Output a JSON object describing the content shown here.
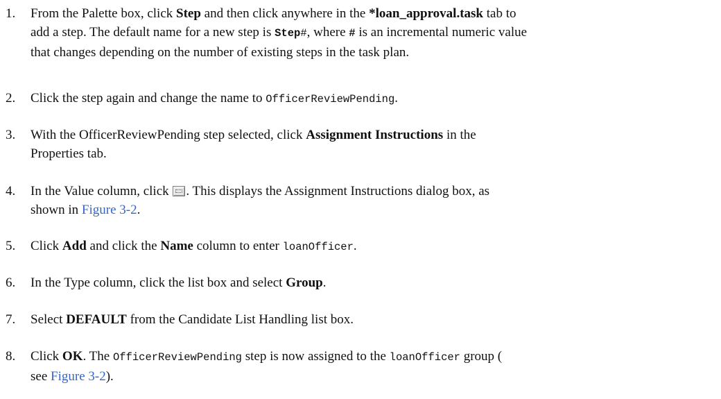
{
  "steps": [
    {
      "num": "1.",
      "lines": [
        {
          "a": "From the Palette box, click ",
          "b": "Step",
          "c": " and then click anywhere in the ",
          "d": "*loan_approval.task",
          "e": " tab to"
        },
        {
          "a": "add a step. The default name for a new step is ",
          "code": "Step",
          "codehash": "#",
          "b": ", where ",
          "hash": "#",
          "c": " is an incremental numeric value"
        },
        {
          "a": "that changes depending on the number of existing steps in the task plan."
        }
      ]
    },
    {
      "num": "2.",
      "a": "Click the step again and change the name to ",
      "code": "OfficerReviewPending",
      "b": "."
    },
    {
      "num": "3.",
      "line1": {
        "a": "With the OfficerReviewPending step selected, click ",
        "b": "Assignment Instructions",
        "c": " in the"
      },
      "line2": "Properties tab."
    },
    {
      "num": "4.",
      "line1": {
        "a": "In the Value column, click ",
        "b": ". This displays the Assignment Instructions dialog box, as"
      },
      "line2": {
        "a": "shown in ",
        "link": "Figure 3-2",
        "b": "."
      }
    },
    {
      "num": "5.",
      "a": "Click ",
      "b": "Add",
      "c": " and click the ",
      "d": "Name",
      "e": " column to enter ",
      "code": "loanOfficer",
      "f": "."
    },
    {
      "num": "6.",
      "a": "In the Type column, click the list box and select ",
      "b": "Group",
      "c": "."
    },
    {
      "num": "7.",
      "a": "Select ",
      "b": "DEFAULT",
      "c": " from the Candidate List Handling list box."
    },
    {
      "num": "8.",
      "line1": {
        "a": "Click ",
        "b": "OK",
        "c": ". The ",
        "code1": "OfficerReviewPending",
        "d": " step is now assigned to the ",
        "code2": "loanOfficer",
        "e": " group ("
      },
      "line2": {
        "a": "see ",
        "link": "Figure 3-2",
        "b": ")."
      }
    }
  ]
}
